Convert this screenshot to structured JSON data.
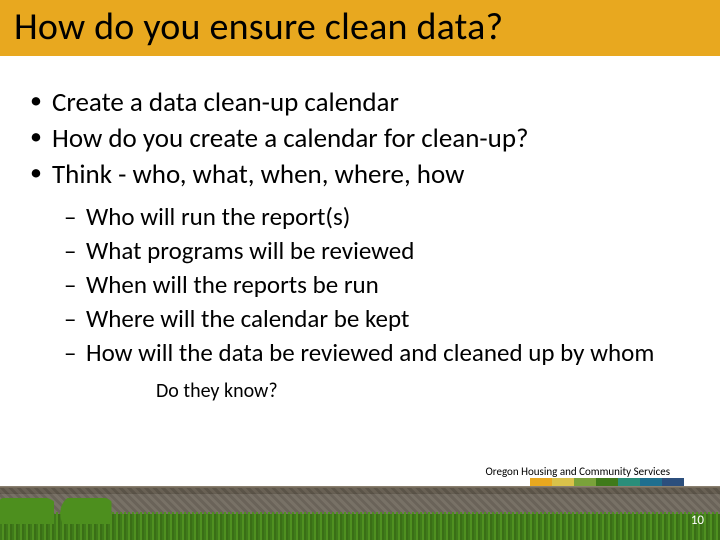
{
  "title": "How do you ensure clean data?",
  "bullets": [
    "Create a data clean-up calendar",
    "How do you create a calendar for clean-up?",
    "Think - who, what, when, where, how"
  ],
  "sub_bullets": [
    "Who will run the report(s)",
    "What programs will be reviewed",
    "When will the reports be run",
    "Where will the calendar be kept",
    "How will the data be reviewed and cleaned up by whom"
  ],
  "subtext": "Do they know?",
  "org_label": "Oregon Housing and Community Services",
  "page_number": "10",
  "strip_colors": [
    "#e8a81f",
    "#d9c24a",
    "#7aa23a",
    "#3f7a1a",
    "#2a8e7a",
    "#1f6f8f",
    "#2c4f7d"
  ]
}
